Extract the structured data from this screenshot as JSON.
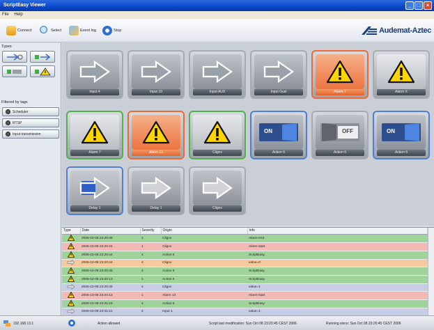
{
  "window": {
    "title": "ScriptEasy Viewer",
    "minimize": "_",
    "maximize": "□",
    "close": "×"
  },
  "menu": [
    "File",
    "Help"
  ],
  "toolbar": {
    "connect": "Connect",
    "select": "Select",
    "event_log": "Event log",
    "stop": "Stop",
    "logo_text": "Audemat-Aztec"
  },
  "sidebar": {
    "types_label": "Types",
    "filter_label": "Filtered by tags",
    "filters": [
      "Scheduler",
      "RTSP",
      "Input transmission"
    ]
  },
  "tiles": [
    {
      "label": "Input 4",
      "kind": "input",
      "state": "normal",
      "border": "none"
    },
    {
      "label": "Input 10",
      "kind": "input",
      "state": "normal",
      "border": "none"
    },
    {
      "label": "Input AUX",
      "kind": "input",
      "state": "normal",
      "border": "none"
    },
    {
      "label": "Input Gusl",
      "kind": "input",
      "state": "normal",
      "border": "none"
    },
    {
      "label": "Alarm 7",
      "kind": "alarm",
      "state": "selected",
      "border": "orange"
    },
    {
      "label": "Alarm X",
      "kind": "alarm",
      "state": "normal",
      "border": "none"
    },
    {
      "label": "Alarm 7",
      "kind": "alarm",
      "state": "normal",
      "border": "green"
    },
    {
      "label": "Alarm 13",
      "kind": "alarm",
      "state": "selected",
      "border": "orange"
    },
    {
      "label": "Clignx",
      "kind": "alarm",
      "state": "normal",
      "border": "green"
    },
    {
      "label": "Action 6",
      "kind": "on",
      "state": "normal",
      "border": "blue"
    },
    {
      "label": "Action 6",
      "kind": "off",
      "state": "normal",
      "border": "none"
    },
    {
      "label": "Action 6",
      "kind": "on",
      "state": "normal",
      "border": "blue"
    },
    {
      "label": "Delay 1",
      "kind": "delay-active",
      "state": "normal",
      "border": "blue"
    },
    {
      "label": "Delay 1",
      "kind": "delay",
      "state": "normal",
      "border": "none"
    },
    {
      "label": "Clignx",
      "kind": "delay",
      "state": "normal",
      "border": "none"
    }
  ],
  "switch_text": {
    "on": "ON",
    "off": "OFF"
  },
  "log": {
    "headers": [
      "Type",
      "Date",
      "Severity",
      "Origin",
      "Info"
    ],
    "rows": [
      {
        "type": "alarm",
        "date": "2006-10-08 23:20:45",
        "sev": "1",
        "origin": "Clignx",
        "info": "Alarm-end",
        "color": "#9fd39a"
      },
      {
        "type": "alarm",
        "date": "2006-10-08 23:20:15",
        "sev": "1",
        "origin": "Clignx",
        "info": "Alarm-start",
        "color": "#f3b9b4"
      },
      {
        "type": "alarm",
        "date": "2006-10-08 23:20:44",
        "sev": "4",
        "origin": "Action 6",
        "info": "ScriptEasy",
        "color": "#9fd39a"
      },
      {
        "type": "input",
        "date": "2006-10-08 23:20:44",
        "sev": "4",
        "origin": "Clignx",
        "info": "value=0",
        "color": "#f5c89d"
      },
      {
        "type": "alarm",
        "date": "2006-10-08 23:20:45",
        "sev": "4",
        "origin": "Action 5",
        "info": "ScriptEasy",
        "color": "#9fd39a"
      },
      {
        "type": "alarm",
        "date": "2006-10-08 23:20:13",
        "sev": "1",
        "origin": "Action 6",
        "info": "ScriptEasy",
        "color": "#9fd39a"
      },
      {
        "type": "input",
        "date": "2006-10-08 23:20:45",
        "sev": "4",
        "origin": "Clignx",
        "info": "value=1",
        "color": "#c8cde6"
      },
      {
        "type": "alarm",
        "date": "2006-10-08 23:20:13",
        "sev": "1",
        "origin": "Alarm 13",
        "info": "Alarm-start",
        "color": "#f3b9b4"
      },
      {
        "type": "alarm",
        "date": "2006-10-08 23:31:19",
        "sev": "4",
        "origin": "Action 6",
        "info": "ScriptEasy",
        "color": "#9fd39a"
      },
      {
        "type": "input",
        "date": "2006-10-08 23:31:21",
        "sev": "4",
        "origin": "Input 1",
        "info": "value=1",
        "color": "#c8cde6"
      }
    ]
  },
  "status": {
    "host": "192.168.13.1",
    "action": "Action allowed",
    "modified": "Script last modification: Sun Oct 08 23:20:45 CEST 2006",
    "running": "Running since: Sun Oct 08 23:20:45 CEST 2006"
  },
  "colors": {
    "orange": "#ee6a35",
    "green": "#54b04a",
    "blue": "#4f7fd0"
  }
}
